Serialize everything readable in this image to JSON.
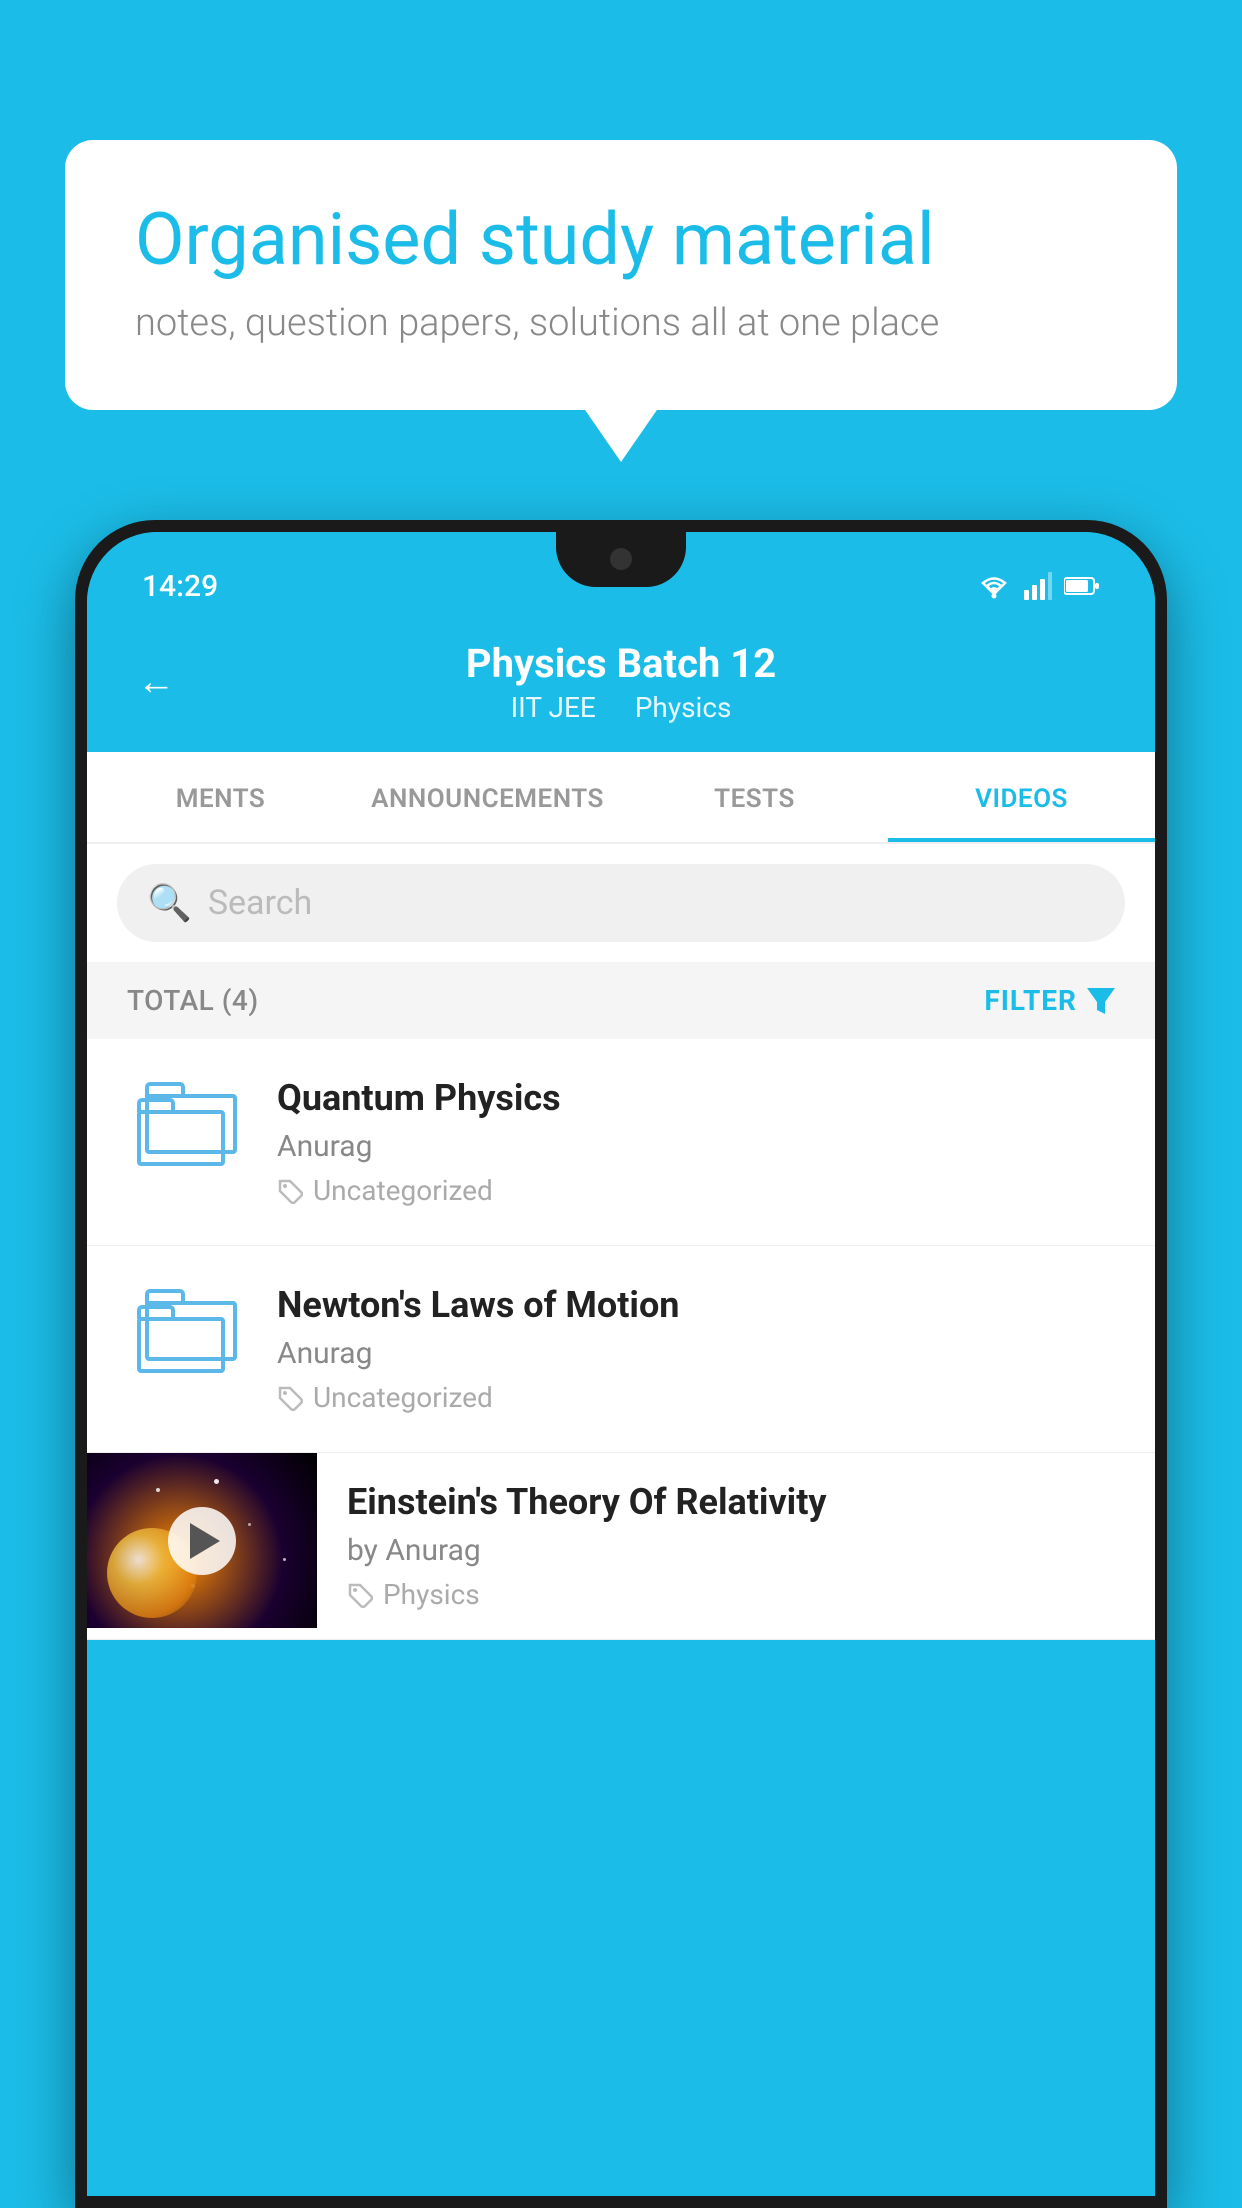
{
  "background_color": "#1BBDE8",
  "bubble": {
    "title": "Organised study material",
    "subtitle": "notes, question papers, solutions all at one place"
  },
  "status_bar": {
    "time": "14:29",
    "icons": [
      "wifi",
      "signal",
      "battery"
    ]
  },
  "header": {
    "title": "Physics Batch 12",
    "subtitle_1": "IIT JEE",
    "subtitle_2": "Physics",
    "back_label": "←"
  },
  "tabs": [
    {
      "label": "MENTS",
      "active": false
    },
    {
      "label": "ANNOUNCEMENTS",
      "active": false
    },
    {
      "label": "TESTS",
      "active": false
    },
    {
      "label": "VIDEOS",
      "active": true
    }
  ],
  "search": {
    "placeholder": "Search"
  },
  "filter": {
    "total_label": "TOTAL (4)",
    "filter_label": "FILTER"
  },
  "videos": [
    {
      "title": "Quantum Physics",
      "author": "Anurag",
      "tag": "Uncategorized",
      "type": "folder"
    },
    {
      "title": "Newton's Laws of Motion",
      "author": "Anurag",
      "tag": "Uncategorized",
      "type": "folder"
    },
    {
      "title": "Einstein's Theory Of Relativity",
      "author": "by Anurag",
      "tag": "Physics",
      "type": "video"
    }
  ]
}
